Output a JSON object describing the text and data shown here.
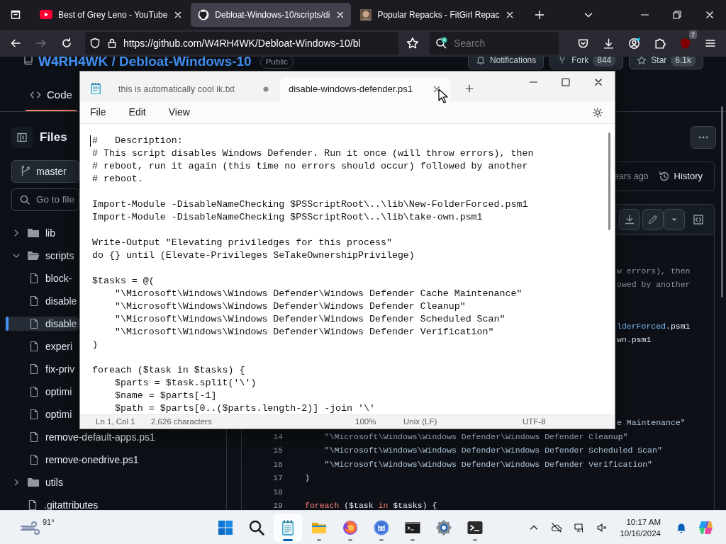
{
  "browser": {
    "tabs": [
      {
        "kind": "video",
        "title": "Best of Grey Leno - YouTube",
        "selected": false
      },
      {
        "kind": "repo",
        "title": "Debloat-Windows-10/scripts/di",
        "selected": true
      },
      {
        "kind": "picture",
        "title": "Popular Repacks - FitGirl Repac",
        "selected": false
      }
    ],
    "buttons": [
      {
        "kind": "back",
        "disabled": false
      },
      {
        "kind": "forward",
        "disabled": true
      },
      {
        "kind": "reload",
        "disabled": false
      }
    ],
    "url": "https://github.com/W4RH4WK/Debloat-Windows-10/bl",
    "search": {
      "placeholder": "Search"
    },
    "extensions_badge": "7"
  },
  "github": {
    "owner": "W4RH4WK",
    "separator": "/",
    "repo": "Debloat-Windows-10",
    "visibility": "Public",
    "actions": [
      {
        "label": "Notifications"
      },
      {
        "label": "Fork",
        "count": "844"
      },
      {
        "label": "Star",
        "count": "6.1k"
      }
    ],
    "tabs": [
      {
        "label": "Code",
        "selected": true
      }
    ],
    "sidebar": {
      "title": "Files",
      "branch": "master",
      "search_placeholder": "Go to file",
      "tree": [
        {
          "kind": "folder",
          "name": "lib",
          "expanded": false
        },
        {
          "kind": "folder",
          "name": "scripts",
          "expanded": true,
          "children": [
            {
              "kind": "file",
              "name": "block-",
              "selected": false
            },
            {
              "kind": "file",
              "name": "disable",
              "selected": false
            },
            {
              "kind": "file",
              "name": "disable",
              "selected": true
            },
            {
              "kind": "file",
              "name": "experi",
              "selected": false
            },
            {
              "kind": "file",
              "name": "fix-priv",
              "selected": false
            },
            {
              "kind": "file",
              "name": "optimi",
              "selected": false
            },
            {
              "kind": "file",
              "name": "optimi",
              "selected": false
            },
            {
              "kind": "file",
              "name": "remove-default-apps.ps1",
              "selected": false
            },
            {
              "kind": "file",
              "name": "remove-onedrive.ps1",
              "selected": false
            }
          ]
        },
        {
          "kind": "folder",
          "name": "utils",
          "expanded": false
        },
        {
          "kind": "file",
          "name": ".gitattributes",
          "selected": false
        }
      ]
    },
    "commit": {
      "time": "ears ago",
      "history": "History"
    },
    "code": {
      "rows": [
        {
          "kind": "covered"
        },
        {
          "kind": "covered",
          "tokens": [
            {
              "kind": "comment",
              "text": "w errors), then"
            }
          ]
        },
        {
          "kind": "covered",
          "tokens": [
            {
              "kind": "comment",
              "text": "owed by another"
            }
          ]
        },
        {
          "kind": "covered"
        },
        {
          "kind": "covered"
        },
        {
          "kind": "covered",
          "tokens": [
            {
              "kind": "name",
              "text": "lderForced"
            },
            {
              "kind": "plain",
              "text": ".psm1"
            }
          ]
        },
        {
          "kind": "covered",
          "tokens": [
            {
              "kind": "plain",
              "text": "wn.psm1"
            }
          ]
        },
        {
          "kind": "covered"
        },
        {
          "kind": "covered"
        },
        {
          "kind": "covered"
        },
        {
          "kind": "covered"
        },
        {
          "kind": "covered"
        },
        {
          "kind": "covered",
          "tokens": [
            {
              "kind": "string",
              "text": "e Maintenance\""
            }
          ]
        },
        {
          "kind": "line",
          "number": "14",
          "tokens": [
            {
              "kind": "string",
              "text": "    \"\\Microsoft\\Windows\\Windows Defender\\Windows Defender Cleanup\""
            }
          ]
        },
        {
          "kind": "line",
          "number": "15",
          "tokens": [
            {
              "kind": "string",
              "text": "    \"\\Microsoft\\Windows\\Windows Defender\\Windows Defender Scheduled Scan\""
            }
          ]
        },
        {
          "kind": "line",
          "number": "16",
          "tokens": [
            {
              "kind": "string",
              "text": "    \"\\Microsoft\\Windows\\Windows Defender\\Windows Defender Verification\""
            }
          ]
        },
        {
          "kind": "line",
          "number": "17",
          "tokens": [
            {
              "kind": "plain",
              "text": ")"
            }
          ]
        },
        {
          "kind": "line",
          "number": "18"
        },
        {
          "kind": "line",
          "number": "19",
          "tokens": [
            {
              "kind": "keyword",
              "text": "foreach"
            },
            {
              "kind": "plain",
              "text": " ($task "
            },
            {
              "kind": "keyword",
              "text": "in"
            },
            {
              "kind": "plain",
              "text": " $tasks) {"
            }
          ]
        }
      ]
    }
  },
  "notepad": {
    "tabs": [
      {
        "title": "this is automatically cool ik.txt",
        "selected": false,
        "modified": true
      },
      {
        "title": "disable-windows-defender.ps1",
        "selected": true,
        "modified": false
      }
    ],
    "menu": [
      "File",
      "Edit",
      "View"
    ],
    "blocks": [
      [
        "#   Description:",
        "# This script disables Windows Defender. Run it once (will throw errors), then",
        "# reboot, run it again (this time no errors should occur) followed by another",
        "# reboot."
      ],
      [
        "Import-Module -DisableNameChecking $PSScriptRoot\\..\\lib\\New-FolderForced.psm1",
        "Import-Module -DisableNameChecking $PSScriptRoot\\..\\lib\\take-own.psm1"
      ],
      [
        "Write-Output \"Elevating priviledges for this process\"",
        "do {} until (Elevate-Privileges SeTakeOwnershipPrivilege)"
      ],
      [
        "$tasks = @(",
        "    \"\\Microsoft\\Windows\\Windows Defender\\Windows Defender Cache Maintenance\"",
        "    \"\\Microsoft\\Windows\\Windows Defender\\Windows Defender Cleanup\"",
        "    \"\\Microsoft\\Windows\\Windows Defender\\Windows Defender Scheduled Scan\"",
        "    \"\\Microsoft\\Windows\\Windows Defender\\Windows Defender Verification\"",
        ")"
      ],
      [
        "foreach ($task in $tasks) {",
        "    $parts = $task.split('\\')",
        "    $name = $parts[-1]",
        "    $path = $parts[0..($parts.length-2)] -join '\\'"
      ]
    ],
    "status": [
      "Ln 1, Col 1",
      "2,626 characters",
      "100%",
      "Unix (LF)",
      "UTF-8"
    ]
  },
  "taskbar": {
    "weather": "91°",
    "apps": [
      {
        "kind": "start",
        "running": false,
        "active": false
      },
      {
        "kind": "search",
        "running": false,
        "active": false
      },
      {
        "kind": "notepad",
        "running": true,
        "active": true
      },
      {
        "kind": "explorer",
        "running": true,
        "active": false
      },
      {
        "kind": "browser",
        "running": true,
        "active": false
      },
      {
        "kind": "torrent",
        "running": true,
        "active": false
      },
      {
        "kind": "console",
        "running": true,
        "active": false
      },
      {
        "kind": "settings",
        "running": false,
        "active": false
      },
      {
        "kind": "terminal",
        "running": true,
        "active": false
      }
    ],
    "time": "10:17 AM",
    "date": "10/16/2024"
  }
}
